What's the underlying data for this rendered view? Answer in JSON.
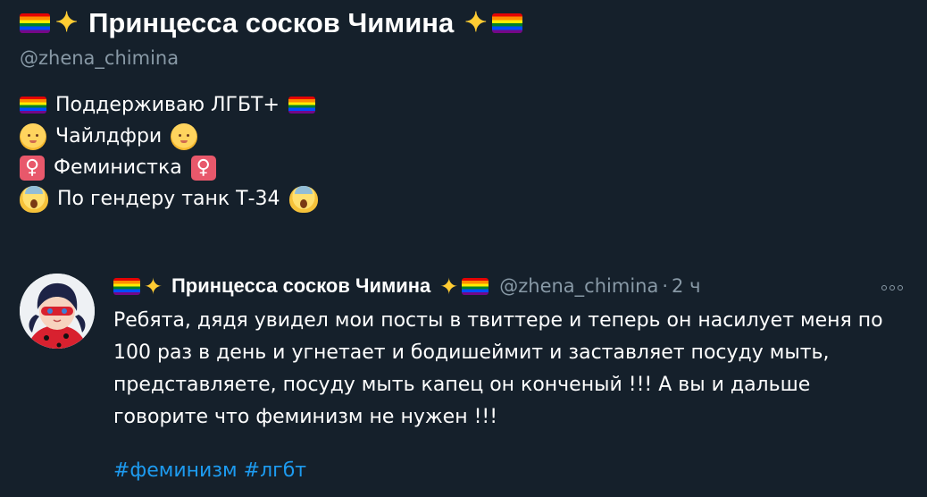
{
  "profile": {
    "display_name": "Принцесса сосков Чимина",
    "handle": "@zhena_chimina",
    "name_emoji": [
      "rainbow-flag-icon",
      "sparkles-icon"
    ]
  },
  "bio": {
    "lines": [
      {
        "text": "Поддерживаю ЛГБТ+",
        "icon": "rainbow-flag-icon"
      },
      {
        "text": "Чайлдфри",
        "icon": "baby-icon"
      },
      {
        "text": "Феминистка",
        "icon": "female-sign-icon"
      },
      {
        "text": "По гендеру танк Т-34",
        "icon": "screaming-face-icon"
      }
    ]
  },
  "tweet": {
    "author_name": "Принцесса сосков Чимина",
    "author_handle": "@zhena_chimina",
    "separator": "·",
    "time": "2 ч",
    "text_lines": [
      "Ребята, дядя увидел мои посты в твиттере и теперь он насилует меня по",
      "100 раз в день и угнетает и бодишеймит и заставляет посуду мыть,",
      "представляете, посуду мыть капец он конченый !!! А вы и дальше",
      "говорите что феминизм не нужен !!!"
    ],
    "hashtags": [
      "#феминизм",
      "#лгбт"
    ]
  },
  "colors": {
    "background": "#15202b",
    "text": "#ffffff",
    "secondary_text": "#8899a6",
    "link": "#1d9bf0"
  }
}
